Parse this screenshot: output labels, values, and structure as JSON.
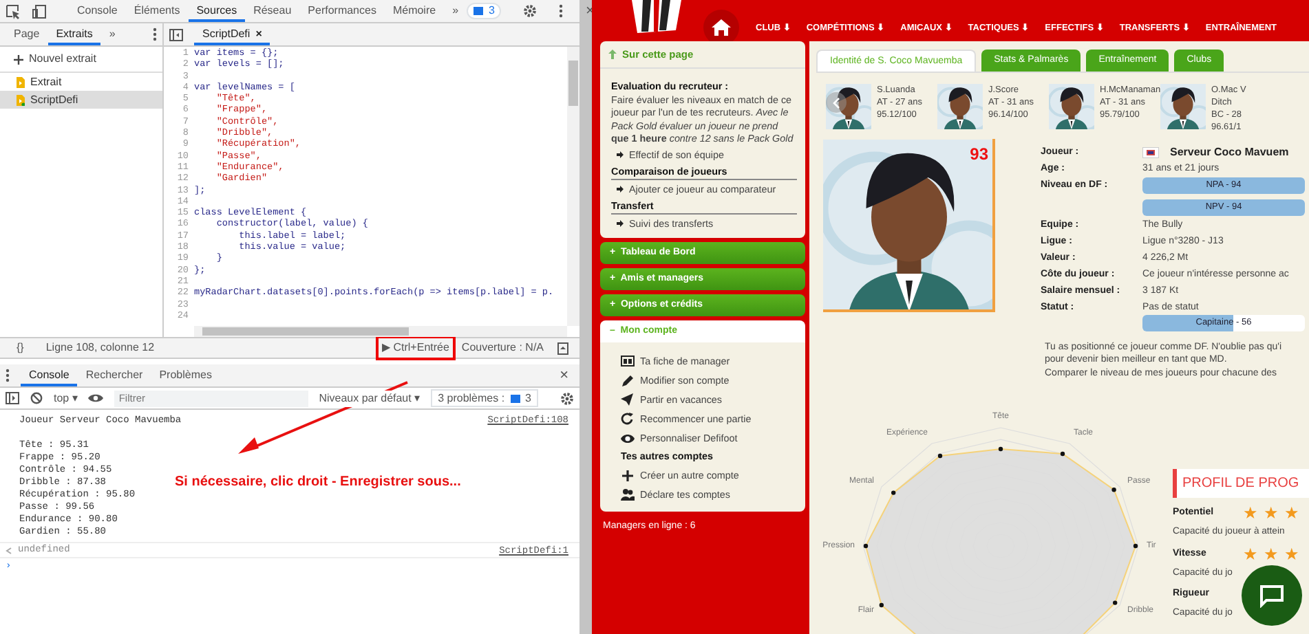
{
  "devtools": {
    "tabs": [
      {
        "label": "Console",
        "selected": false
      },
      {
        "label": "Éléments",
        "selected": false
      },
      {
        "label": "Sources",
        "selected": true
      },
      {
        "label": "Réseau",
        "selected": false
      },
      {
        "label": "Performances",
        "selected": false
      },
      {
        "label": "Mémoire",
        "selected": false
      }
    ],
    "more": "»",
    "issues_badge": "3",
    "close": "×",
    "navigator_tabs": [
      {
        "label": "Page",
        "selected": false
      },
      {
        "label": "Extraits",
        "selected": true
      }
    ],
    "navigator_more": "»",
    "new_snippet": "Nouvel extrait",
    "snippets": [
      {
        "label": "Extrait",
        "selected": false
      },
      {
        "label": "ScriptDefi",
        "selected": true
      }
    ],
    "file_tab": {
      "label": "ScriptDefi",
      "close": "×"
    },
    "code": [
      {
        "n": "1",
        "text": "var items = {};",
        "kind": "code"
      },
      {
        "n": "2",
        "text": "var levels = [];",
        "kind": "code"
      },
      {
        "n": "3",
        "kind": "code"
      },
      {
        "n": "4",
        "text": "var levelNames = [",
        "kind": "code"
      },
      {
        "n": "5",
        "text": "    \"Tête\",",
        "kind": "string"
      },
      {
        "n": "6",
        "text": "    \"Frappe\",",
        "kind": "string"
      },
      {
        "n": "7",
        "text": "    \"Contrôle\",",
        "kind": "string"
      },
      {
        "n": "8",
        "text": "    \"Dribble\",",
        "kind": "string"
      },
      {
        "n": "9",
        "text": "    \"Récupération\",",
        "kind": "string"
      },
      {
        "n": "10",
        "text": "    \"Passe\",",
        "kind": "string"
      },
      {
        "n": "11",
        "text": "    \"Endurance\",",
        "kind": "string"
      },
      {
        "n": "12",
        "text": "    \"Gardien\"",
        "kind": "string"
      },
      {
        "n": "13",
        "text": "];",
        "kind": "code"
      },
      {
        "n": "14",
        "kind": "code"
      },
      {
        "n": "15",
        "text": "class LevelElement {",
        "kind": "code"
      },
      {
        "n": "16",
        "text": "    constructor(label, value) {",
        "kind": "code"
      },
      {
        "n": "17",
        "text": "        this.label = label;",
        "kind": "code"
      },
      {
        "n": "18",
        "text": "        this.value = value;",
        "kind": "code"
      },
      {
        "n": "19",
        "text": "    }",
        "kind": "code"
      },
      {
        "n": "20",
        "text": "};",
        "kind": "code"
      },
      {
        "n": "21",
        "kind": "code"
      },
      {
        "n": "22",
        "text": "myRadarChart.datasets[0].points.forEach(p => items[p.label] = p.",
        "kind": "code"
      },
      {
        "n": "23",
        "kind": "code"
      },
      {
        "n": "24",
        "kind": "code"
      }
    ],
    "status": {
      "braces": "{}",
      "position": "Ligne 108, colonne 12",
      "run": "▶ Ctrl+Entrée",
      "coverage": "Couverture : N/A"
    },
    "drawer_tabs": [
      {
        "label": "Console",
        "selected": true
      },
      {
        "label": "Rechercher",
        "selected": false
      },
      {
        "label": "Problèmes",
        "selected": false
      }
    ],
    "console_toolbar": {
      "context": "top ▾",
      "filter_placeholder": "Filtrer",
      "levels": "Niveaux par défaut ▾",
      "problems": "3 problèmes :",
      "problems_count": "3"
    },
    "console": [
      {
        "kind": "log",
        "text": "Joueur Serveur Coco Mavuemba",
        "source": "ScriptDefi:108"
      },
      {
        "kind": "blank"
      },
      {
        "kind": "log",
        "text": "Tête : 95.31"
      },
      {
        "kind": "log",
        "text": "Frappe : 95.20"
      },
      {
        "kind": "log",
        "text": "Contrôle : 94.55"
      },
      {
        "kind": "log",
        "text": "Dribble : 87.38"
      },
      {
        "kind": "log",
        "text": "Récupération : 95.80"
      },
      {
        "kind": "log",
        "text": "Passe : 99.56"
      },
      {
        "kind": "log",
        "text": "Endurance : 90.80"
      },
      {
        "kind": "log",
        "text": "Gardien : 55.80"
      },
      {
        "kind": "result",
        "text": "undefined",
        "source": "ScriptDefi:1"
      },
      {
        "kind": "prompt",
        "text": "›"
      }
    ],
    "annotation": "Si nécessaire, clic droit - Enregistrer sous..."
  },
  "site": {
    "nav": [
      "CLUB",
      "COMPÉTITIONS",
      "AMICAUX",
      "TACTIQUES",
      "EFFECTIFS",
      "TRANSFERTS",
      "ENTRAÎNEMENT"
    ],
    "nav_caret": "⬇",
    "side": {
      "title": "Sur cette page",
      "blocks": [
        {
          "kind": "heading",
          "text": "Evaluation du recruteur :"
        },
        {
          "kind": "para",
          "text": "Faire évaluer les niveaux en match de ce joueur par l'un de tes recruteurs. *Avec le Pack Gold évaluer un joueur ne prend* **que 1 heure** *contre 12 sans le Pack Gold*"
        },
        {
          "kind": "link",
          "text": "Effectif de son équipe"
        },
        {
          "kind": "section",
          "text": "Comparaison de joueurs"
        },
        {
          "kind": "link",
          "text": "Ajouter ce joueur au comparateur"
        },
        {
          "kind": "section",
          "text": "Transfert"
        },
        {
          "kind": "link",
          "text": "Suivi des transferts"
        }
      ],
      "accordions": [
        {
          "label": "Tableau de Bord",
          "expanded": false,
          "sign": "+"
        },
        {
          "label": "Amis et managers",
          "expanded": false,
          "sign": "+"
        },
        {
          "label": "Options et crédits",
          "expanded": false,
          "sign": "+"
        },
        {
          "label": "Mon compte",
          "expanded": true,
          "sign": "–"
        }
      ],
      "account": [
        {
          "kind": "link",
          "text": "Ta fiche de manager"
        },
        {
          "kind": "link",
          "text": "Modifier son compte"
        },
        {
          "kind": "link",
          "text": "Partir en vacances"
        },
        {
          "kind": "link",
          "text": "Recommencer une partie"
        },
        {
          "kind": "link",
          "text": "Personnaliser Defifoot"
        },
        {
          "kind": "heading",
          "text": "Tes autres comptes"
        },
        {
          "kind": "link",
          "text": "Créer un autre compte"
        },
        {
          "kind": "link",
          "text": "Déclare tes comptes"
        }
      ],
      "online": "Managers en ligne : 6"
    },
    "tabs": [
      {
        "label": "Identité de S. Coco Mavuemba",
        "selected": true
      },
      {
        "label": "Stats & Palmarès",
        "selected": false
      },
      {
        "label": "Entraînement",
        "selected": false
      },
      {
        "label": "Clubs",
        "selected": false
      }
    ],
    "players": [
      {
        "name": "S.Luanda",
        "lines": [
          "AT - 27 ans",
          "95.12/100"
        ]
      },
      {
        "name": "J.Score",
        "lines": [
          "AT - 31 ans",
          "96.14/100"
        ]
      },
      {
        "name": "H.McManaman",
        "lines": [
          "AT - 31 ans",
          "95.79/100"
        ]
      },
      {
        "name": "O.Mac V",
        "lines": [
          "Ditch",
          "BC - 28",
          "96.61/1"
        ]
      }
    ],
    "number": "93",
    "info": [
      {
        "label": "Joueur :",
        "kind": "name",
        "value": "Serveur Coco Mavuem"
      },
      {
        "label": "Age :",
        "kind": "text",
        "value": "31 ans et 21 jours"
      },
      {
        "label": "Niveau en DF :",
        "kind": "bars",
        "bars": [
          {
            "text": "NPA - 94",
            "level": 1
          },
          {
            "text": "NPV - 94",
            "level": 1
          }
        ]
      },
      {
        "label": "Equipe :",
        "kind": "text",
        "value": "The Bully"
      },
      {
        "label": "Ligue :",
        "kind": "text",
        "value": "Ligue n°3280 - J13"
      },
      {
        "label": "Valeur :",
        "kind": "text",
        "value": "4 226,2 Mt"
      },
      {
        "label": "Côte du joueur :",
        "kind": "text",
        "value": "Ce joueur n'intéresse personne ac"
      },
      {
        "label": "Salaire mensuel :",
        "kind": "text",
        "value": "3 187 Kt"
      },
      {
        "label": "Statut :",
        "kind": "status",
        "value": "Pas de statut",
        "bars": [
          {
            "text": "Capitaine - 56",
            "level": 0.56
          }
        ]
      }
    ],
    "notes": [
      "Tu as positionné ce joueur comme DF. N'oublie pas qu'i",
      "pour devenir bien meilleur en tant que MD.",
      "Comparer le niveau de mes joueurs pour chacune des"
    ],
    "radar": {
      "axis_labels_right": [
        "Tête",
        "Tacle",
        "Passe",
        "Tir",
        "Dribble"
      ],
      "axis_labels_left": [
        "Flair",
        "Pression",
        "Mental",
        "Expérience"
      ]
    },
    "profile": {
      "title": "PROFIL DE PROG",
      "items": [
        {
          "label": "Potentiel",
          "stars": 3,
          "desc": "Capacité du joueur à attein"
        },
        {
          "label": "Vitesse",
          "stars": 3,
          "desc": "Capacité du jo"
        },
        {
          "label": "Rigueur",
          "desc": "Capacité du jo"
        }
      ]
    }
  }
}
